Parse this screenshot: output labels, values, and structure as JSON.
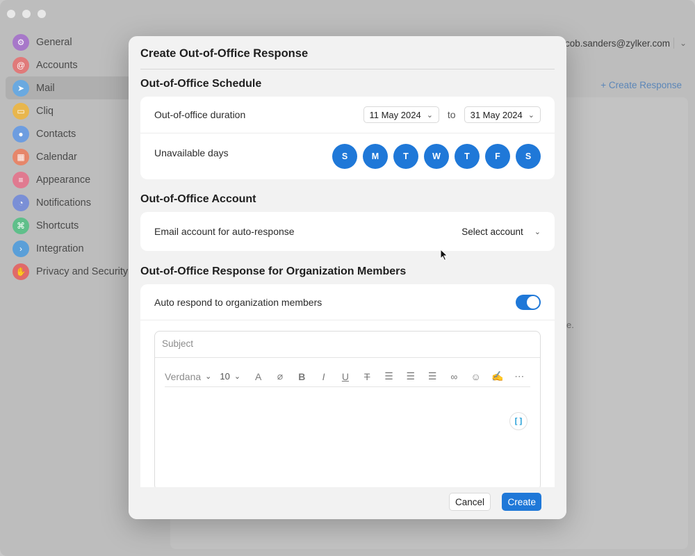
{
  "app": {
    "account_email": "cob.sanders@zylker.com",
    "create_response_label": "+ Create Response",
    "bg_text_fragment": "e."
  },
  "sidebar": {
    "items": [
      {
        "label": "General",
        "icon": "gear-icon",
        "color": "#a778c9",
        "glyph": "⚙"
      },
      {
        "label": "Accounts",
        "icon": "at-icon",
        "color": "#e07a7a",
        "glyph": "@"
      },
      {
        "label": "Mail",
        "icon": "send-icon",
        "color": "#6aa9e0",
        "glyph": "➤"
      },
      {
        "label": "Cliq",
        "icon": "chat-icon",
        "color": "#e8b64d",
        "glyph": "▭"
      },
      {
        "label": "Contacts",
        "icon": "person-icon",
        "color": "#6d9de0",
        "glyph": "●"
      },
      {
        "label": "Calendar",
        "icon": "calendar-icon",
        "color": "#e6866a",
        "glyph": "▦"
      },
      {
        "label": "Appearance",
        "icon": "sliders-icon",
        "color": "#e07a90",
        "glyph": "≡"
      },
      {
        "label": "Notifications",
        "icon": "bell-icon",
        "color": "#7a8fd6",
        "glyph": "◔"
      },
      {
        "label": "Shortcuts",
        "icon": "command-icon",
        "color": "#5fbf8a",
        "glyph": "⌘"
      },
      {
        "label": "Integration",
        "icon": "terminal-icon",
        "color": "#5a9fd8",
        "glyph": "›"
      },
      {
        "label": "Privacy and Security",
        "icon": "hand-icon",
        "color": "#e06a6a",
        "glyph": "✋"
      }
    ],
    "active_index": 2
  },
  "dialog": {
    "title": "Create Out-of-Office Response",
    "schedule": {
      "title": "Out-of-Office Schedule",
      "duration_label": "Out-of-office duration",
      "from_date": "11 May 2024",
      "to_label": "to",
      "to_date": "31 May 2024",
      "unavailable_label": "Unavailable days",
      "days": [
        "S",
        "M",
        "T",
        "W",
        "T",
        "F",
        "S"
      ]
    },
    "account": {
      "title": "Out-of-Office Account",
      "label": "Email account for auto-response",
      "select_value": "Select account"
    },
    "org": {
      "title": "Out-of-Office Response for Organization Members",
      "auto_respond_label": "Auto respond to organization members",
      "auto_respond_on": true,
      "subject_placeholder": "Subject",
      "font": "Verdana",
      "font_size": "10",
      "toolbar_icons": [
        "font-color-icon",
        "clear-format-icon",
        "bold-icon",
        "italic-icon",
        "underline-icon",
        "strikethrough-icon",
        "align-left-icon",
        "align-center-icon",
        "align-right-icon",
        "link-icon",
        "emoji-icon",
        "signature-icon",
        "more-icon"
      ]
    },
    "cancel_label": "Cancel",
    "create_label": "Create"
  },
  "colors": {
    "accent": "#1f78d8"
  }
}
